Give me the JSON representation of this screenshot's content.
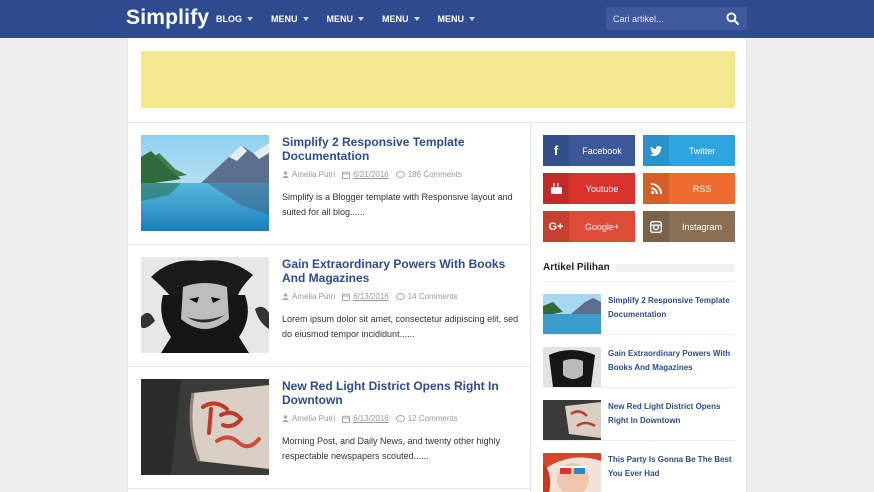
{
  "header": {
    "logo": "Simplify",
    "nav": [
      "BLOG",
      "MENU",
      "MENU",
      "MENU",
      "MENU"
    ],
    "search_placeholder": "Cari artikel..."
  },
  "posts": [
    {
      "title": "Simplify 2 Responsive Template Documentation",
      "author": "Amelia Putri",
      "date": "6/21/2016",
      "comments": "186 Comments",
      "excerpt": "Simplify is a Blogger template with Responsive layout and suited for all blog......"
    },
    {
      "title": "Gain Extraordinary Powers With Books And Magazines",
      "author": "Amelia Putri",
      "date": "6/13/2016",
      "comments": "14 Comments",
      "excerpt": "Lorem ipsum dolor sit amet, consectetur adipiscing elit, sed do eiusmod tempor incididunt......"
    },
    {
      "title": "New Red Light District Opens Right In Downtown",
      "author": "Amelia Putri",
      "date": "6/13/2016",
      "comments": "12 Comments",
      "excerpt": "Morning Post, and Daily News, and twenty other highly respectable newspapers scouted......"
    }
  ],
  "social": [
    {
      "label": "Facebook",
      "icon": "facebook-icon",
      "color": "#3b5998"
    },
    {
      "label": "Twitter",
      "icon": "twitter-icon",
      "color": "#2ea4de"
    },
    {
      "label": "Youtube",
      "icon": "youtube-icon",
      "color": "#d8322f"
    },
    {
      "label": "RSS",
      "icon": "rss-icon",
      "color": "#ef6b30"
    },
    {
      "label": "Google+",
      "icon": "google-plus-icon",
      "color": "#dd4b39"
    },
    {
      "label": "Instagram",
      "icon": "instagram-icon",
      "color": "#8a6f54"
    }
  ],
  "featured": {
    "title": "Artikel Pilihan",
    "items": [
      "Simplify 2 Responsive Template Documentation",
      "Gain Extraordinary Powers With Books And Magazines",
      "New Red Light District Opens Right In Downtown",
      "This Party Is Gonna Be The Best You Ever Had"
    ]
  },
  "colors": {
    "header": "#2f4b8f",
    "link": "#2f4b8f",
    "ad_banner": "#f4e88f"
  }
}
